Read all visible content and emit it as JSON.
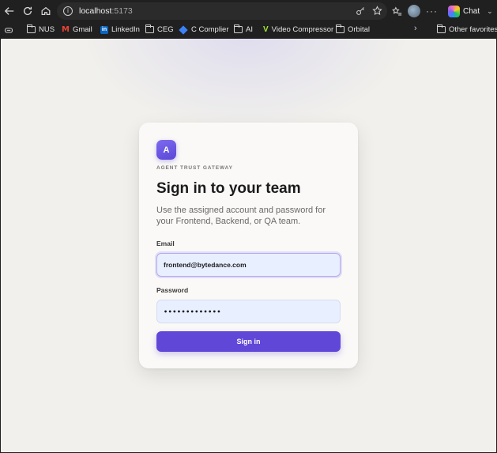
{
  "browser": {
    "url_host": "localhost",
    "url_port": ":5173",
    "chat_label": "Chat"
  },
  "bookmarks": [
    {
      "label": "NUS",
      "icon": "folder-icon"
    },
    {
      "label": "Gmail",
      "icon": "gmail-icon"
    },
    {
      "label": "LinkedIn",
      "icon": "linkedin-icon"
    },
    {
      "label": "CEG",
      "icon": "folder-icon"
    },
    {
      "label": "C Complier",
      "icon": "c-complier-icon"
    },
    {
      "label": "AI",
      "icon": "folder-icon"
    },
    {
      "label": "Video Compressor",
      "icon": "video-compressor-icon"
    },
    {
      "label": "Orbital",
      "icon": "folder-icon"
    },
    {
      "label": "Other favorites",
      "icon": "folder-icon"
    }
  ],
  "login": {
    "logo_letter": "A",
    "eyebrow": "AGENT TRUST GATEWAY",
    "title": "Sign in to your team",
    "subtitle": "Use the assigned account and password for your Frontend, Backend, or QA team.",
    "email_label": "Email",
    "email_value": "frontend@bytedance.com",
    "password_label": "Password",
    "password_value": "•••••••••••••",
    "submit_label": "Sign in"
  },
  "colors": {
    "accent": "#6147d8",
    "input_bg": "#e8efff",
    "page_bg": "#f1f0ec"
  }
}
